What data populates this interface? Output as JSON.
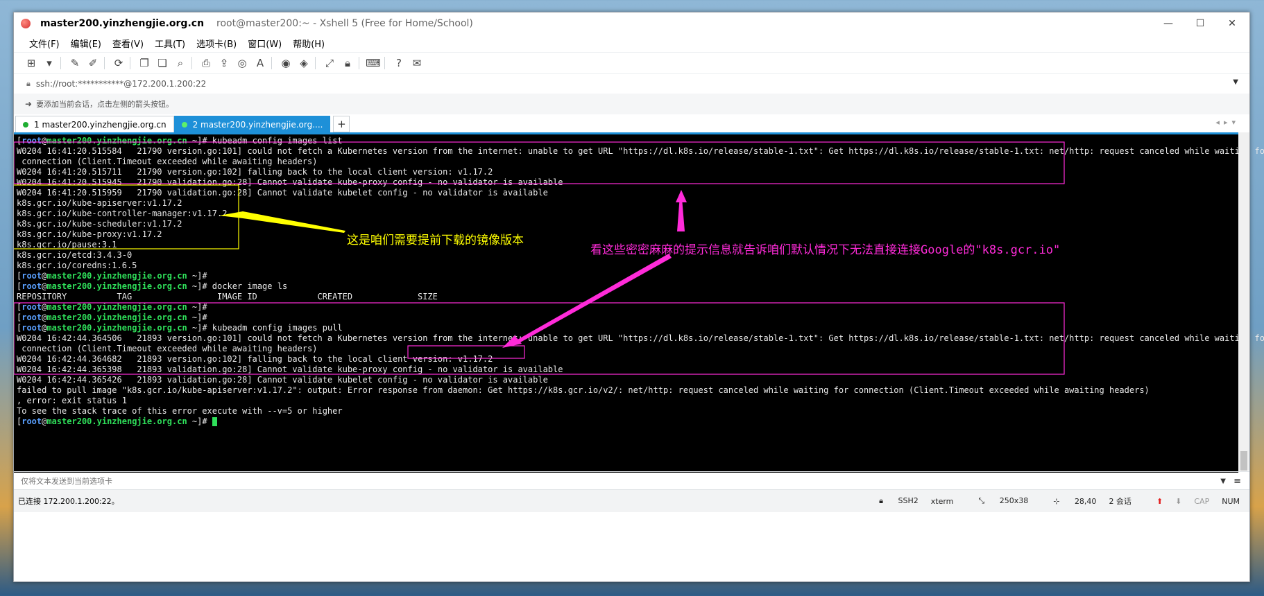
{
  "window": {
    "title": "master200.yinzhengjie.org.cn",
    "subtitle": "root@master200:~ - Xshell 5 (Free for Home/School)",
    "minimize": "—",
    "maximize": "☐",
    "close": "✕"
  },
  "menu": [
    "文件(F)",
    "编辑(E)",
    "查看(V)",
    "工具(T)",
    "选项卡(B)",
    "窗口(W)",
    "帮助(H)"
  ],
  "address": {
    "text": "ssh://root:***********@172.200.1.200:22"
  },
  "hint": {
    "text": "要添加当前会话，点击左侧的箭头按钮。"
  },
  "tabs": [
    {
      "label": "1 master200.yinzhengjie.org.cn",
      "active": false
    },
    {
      "label": "2 master200.yinzhengjie.org....",
      "active": true
    }
  ],
  "prompt": {
    "open": "[",
    "user": "root",
    "at": "@",
    "host": "master200.yinzhengjie.org.cn",
    "tail": " ~]# "
  },
  "terminal_lines": [
    {
      "type": "prompt",
      "cmd": "kubeadm config images list"
    },
    {
      "type": "text",
      "text": "W0204 16:41:20.515584   21790 version.go:101] could not fetch a Kubernetes version from the internet: unable to get URL \"https://dl.k8s.io/release/stable-1.txt\": Get https://dl.k8s.io/release/stable-1.txt: net/http: request canceled while waiting for"
    },
    {
      "type": "text",
      "text": " connection (Client.Timeout exceeded while awaiting headers)"
    },
    {
      "type": "text",
      "text": "W0204 16:41:20.515711   21790 version.go:102] falling back to the local client version: v1.17.2"
    },
    {
      "type": "text",
      "text": "W0204 16:41:20.515945   21790 validation.go:28] Cannot validate kube-proxy config - no validator is available"
    },
    {
      "type": "text",
      "text": "W0204 16:41:20.515959   21790 validation.go:28] Cannot validate kubelet config - no validator is available"
    },
    {
      "type": "text",
      "text": "k8s.gcr.io/kube-apiserver:v1.17.2"
    },
    {
      "type": "text",
      "text": "k8s.gcr.io/kube-controller-manager:v1.17.2"
    },
    {
      "type": "text",
      "text": "k8s.gcr.io/kube-scheduler:v1.17.2"
    },
    {
      "type": "text",
      "text": "k8s.gcr.io/kube-proxy:v1.17.2"
    },
    {
      "type": "text",
      "text": "k8s.gcr.io/pause:3.1"
    },
    {
      "type": "text",
      "text": "k8s.gcr.io/etcd:3.4.3-0"
    },
    {
      "type": "text",
      "text": "k8s.gcr.io/coredns:1.6.5"
    },
    {
      "type": "prompt",
      "cmd": ""
    },
    {
      "type": "prompt",
      "cmd": "docker image ls"
    },
    {
      "type": "text",
      "text": "REPOSITORY          TAG                 IMAGE ID            CREATED             SIZE"
    },
    {
      "type": "prompt",
      "cmd": ""
    },
    {
      "type": "prompt",
      "cmd": ""
    },
    {
      "type": "prompt",
      "cmd": "kubeadm config images pull"
    },
    {
      "type": "text",
      "text": "W0204 16:42:44.364506   21893 version.go:101] could not fetch a Kubernetes version from the internet: unable to get URL \"https://dl.k8s.io/release/stable-1.txt\": Get https://dl.k8s.io/release/stable-1.txt: net/http: request canceled while waiting for"
    },
    {
      "type": "text",
      "text": " connection (Client.Timeout exceeded while awaiting headers)"
    },
    {
      "type": "text",
      "text": "W0204 16:42:44.364682   21893 version.go:102] falling back to the local client version: v1.17.2"
    },
    {
      "type": "text",
      "text": "W0204 16:42:44.365398   21893 validation.go:28] Cannot validate kube-proxy config - no validator is available"
    },
    {
      "type": "text",
      "text": "W0204 16:42:44.365426   21893 validation.go:28] Cannot validate kubelet config - no validator is available"
    },
    {
      "type": "text",
      "text": "failed to pull image \"k8s.gcr.io/kube-apiserver:v1.17.2\": output: Error response from daemon: Get https://k8s.gcr.io/v2/: net/http: request canceled while waiting for connection (Client.Timeout exceeded while awaiting headers)"
    },
    {
      "type": "text",
      "text": ", error: exit status 1"
    },
    {
      "type": "text",
      "text": "To see the stack trace of this error execute with --v=5 or higher"
    },
    {
      "type": "prompt",
      "cmd": "",
      "cursor": true
    }
  ],
  "annotations": {
    "yellow_text": "这是咱们需要提前下载的镜像版本",
    "magenta_text": "看这些密密麻麻的提示信息就告诉咱们默认情况下无法直接连接Google的\"k8s.gcr.io\"",
    "yellow_color": "#ffff00",
    "magenta_color": "#ff2bd9"
  },
  "send_bar": {
    "placeholder": "仅将文本发送到当前选项卡"
  },
  "status": {
    "connection": "已连接 172.200.1.200:22。",
    "protocol": "SSH2",
    "term": "xterm",
    "size": "250x38",
    "cursor_pos": "28,40",
    "sessions": "2 会话",
    "caps": "CAP",
    "num": "NUM"
  }
}
